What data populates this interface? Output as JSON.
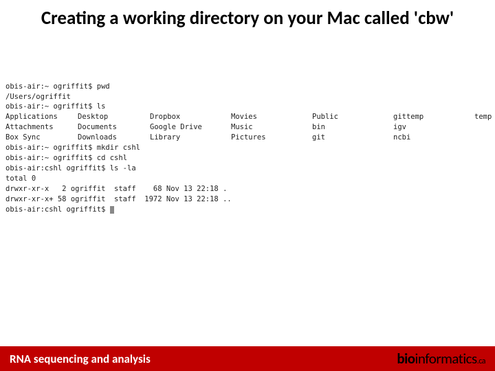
{
  "title": "Creating a working directory on your Mac called 'cbw'",
  "terminal": {
    "prompt1": "obis-air:~ ogriffit$ ",
    "prompt2": "obis-air:cshl ogriffit$ ",
    "cmd_pwd": "pwd",
    "out_pwd": "/Users/ogriffit",
    "cmd_ls": "ls",
    "ls_cols": {
      "r0": [
        "Applications",
        "Desktop",
        "Dropbox",
        "Movies",
        "Public",
        "gittemp",
        "temp"
      ],
      "r1": [
        "Attachments",
        "Documents",
        "Google Drive",
        "Music",
        "bin",
        "igv",
        ""
      ],
      "r2": [
        "Box Sync",
        "Downloads",
        "Library",
        "Pictures",
        "git",
        "ncbi",
        ""
      ]
    },
    "cmd_mkdir": "mkdir cshl",
    "cmd_cd": "cd cshl",
    "cmd_lsla": "ls -la",
    "out_total": "total 0",
    "out_d1": "drwxr-xr-x   2 ogriffit  staff    68 Nov 13 22:18 .",
    "out_d2": "drwxr-xr-x+ 58 ogriffit  staff  1972 Nov 13 22:18 .."
  },
  "footer": {
    "left": "RNA sequencing and analysis",
    "right_bio": "bio",
    "right_inf": "informatics",
    "right_ca": ".ca"
  }
}
